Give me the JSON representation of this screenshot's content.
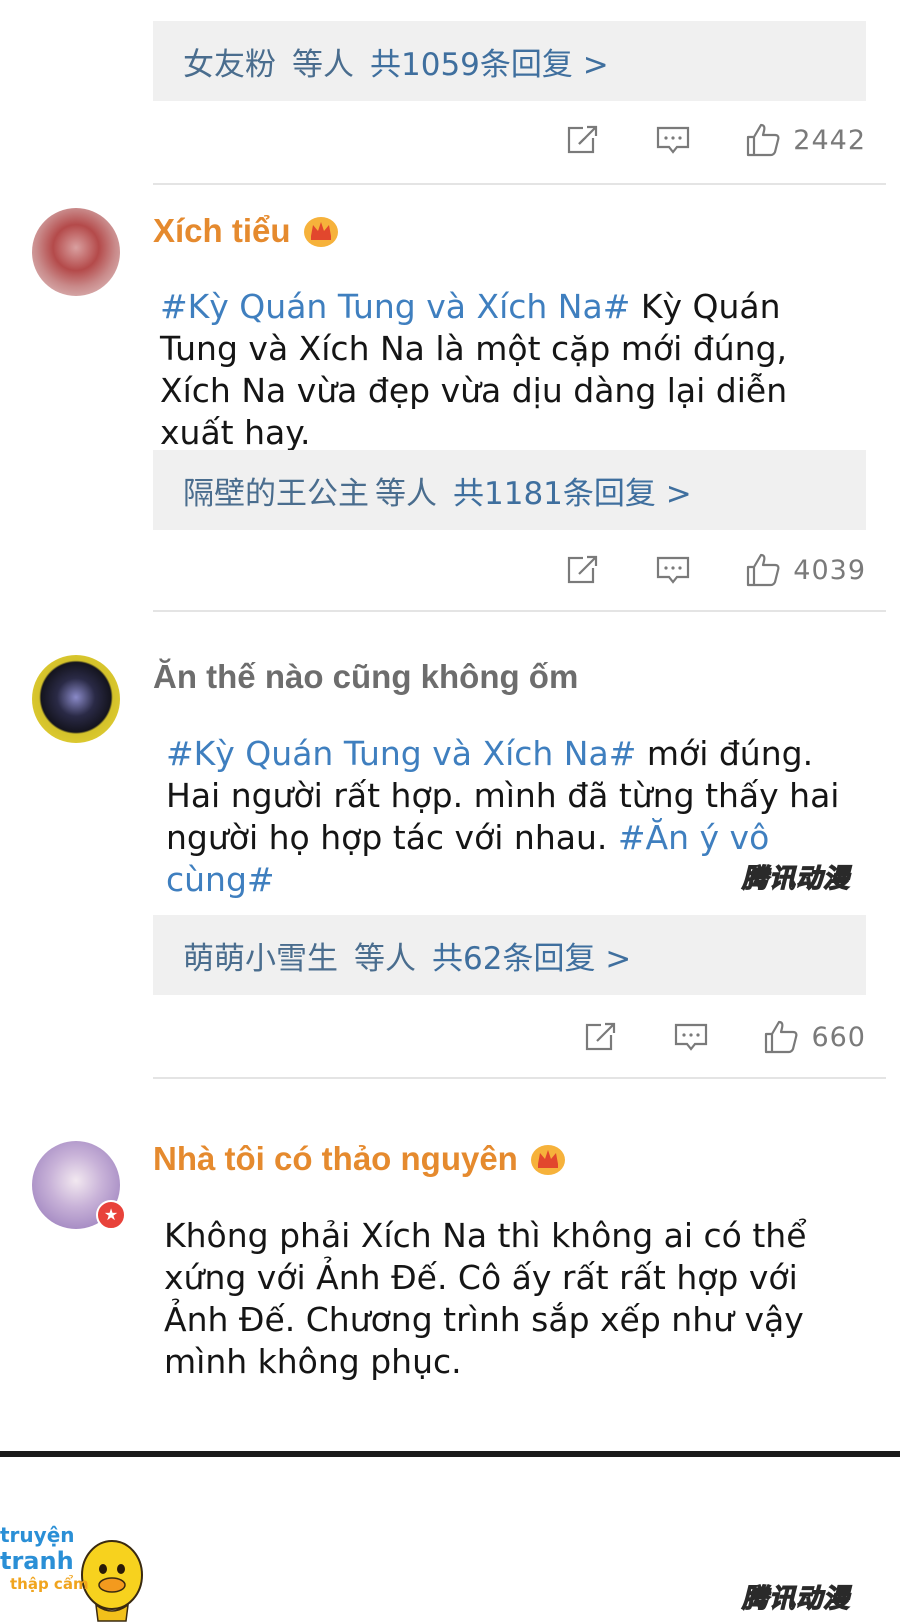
{
  "comments": [
    {
      "replies": {
        "who": "女友粉",
        "who_suffix": "等人",
        "count_text": "共1059条回复 >"
      },
      "likes": "2442"
    },
    {
      "username": "Xích tiểu",
      "content_tag": "#Kỳ Quán Tung và Xích Na#",
      "content_text": " Kỳ Quán Tung và Xích Na là một cặp mới đúng, Xích Na vừa đẹp vừa dịu dàng lại diễn xuất hay.",
      "replies": {
        "who": "隔壁的王公主",
        "who_suffix": "等人",
        "count_text": "共1181条回复 >"
      },
      "likes": "4039"
    },
    {
      "username": "Ăn thế nào cũng không ốm",
      "content_tag": "#Kỳ Quán Tung và Xích Na#",
      "content_text": " mới đúng. Hai người rất hợp. mình đã từng thấy hai người họ hợp tác với nhau. ",
      "content_tag2": "#Ăn ý vô cùng#",
      "replies": {
        "who": "萌萌小雪生",
        "who_suffix": "等人",
        "count_text": "共62条回复 >"
      },
      "likes": "660"
    },
    {
      "username": "Nhà tôi có thảo nguyên",
      "content_text": "Không phải Xích Na thì không ai có thể xứng với Ảnh Đế. Cô ấy rất rất hợp với Ảnh Đế. Chương trình sắp xếp như vậy mình không phục."
    }
  ],
  "watermark": "腾讯动漫",
  "logo": {
    "line1": "truyện",
    "line2": "tranh",
    "line3": "thập cẩm"
  },
  "icons": {
    "share": "share-icon",
    "comment": "comment-icon",
    "like": "like-icon",
    "crown": "crown-icon"
  },
  "colors": {
    "username_orange": "#e58a2e",
    "hashtag_blue": "#3f7fbf",
    "reply_bg": "#f0f0f0",
    "reply_text": "#4a6d8e"
  }
}
